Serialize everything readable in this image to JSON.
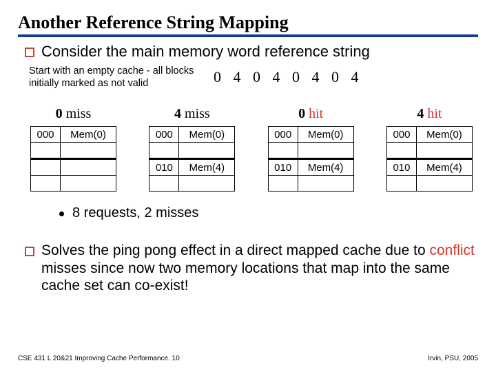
{
  "title": "Another Reference String Mapping",
  "bullet1": "Consider the main memory word reference string",
  "sub_left": "Start with an empty cache - all blocks initially marked as not valid",
  "ref_string": "0 4 0 4 0 4 0 4",
  "cols": [
    {
      "hn": "0",
      "ht": "miss",
      "hitclass": "",
      "rows": [
        [
          "000",
          "Mem(0)"
        ],
        [
          "",
          ""
        ],
        [
          "",
          ""
        ],
        [
          "",
          ""
        ]
      ]
    },
    {
      "hn": "4",
      "ht": "miss",
      "hitclass": "",
      "rows": [
        [
          "000",
          "Mem(0)"
        ],
        [
          "",
          ""
        ],
        [
          "010",
          "Mem(4)"
        ],
        [
          "",
          ""
        ]
      ]
    },
    {
      "hn": "0",
      "ht": "hit",
      "hitclass": "hit",
      "rows": [
        [
          "000",
          "Mem(0)"
        ],
        [
          "",
          ""
        ],
        [
          "010",
          "Mem(4)"
        ],
        [
          "",
          ""
        ]
      ]
    },
    {
      "hn": "4",
      "ht": "hit",
      "hitclass": "hit",
      "rows": [
        [
          "000",
          "Mem(0)"
        ],
        [
          "",
          ""
        ],
        [
          "010",
          "Mem(4)"
        ],
        [
          "",
          ""
        ]
      ]
    }
  ],
  "requests": "8 requests, 2 misses",
  "solve_pre": "Solves the ping pong effect in a direct mapped cache due to ",
  "solve_conf": "conflict",
  "solve_post": " misses since now two memory locations that map into the same cache set can co-exist!",
  "footer_left": "CSE 431  L 20&21 Improving Cache Performance. 10",
  "footer_right": "Irvin, PSU, 2005",
  "chart_data": {
    "type": "table",
    "title": "Another Reference String Mapping",
    "reference_string": [
      0,
      4,
      0,
      4,
      0,
      4,
      0,
      4
    ],
    "steps": [
      {
        "access": 0,
        "result": "miss",
        "cache": [
          [
            "000",
            "Mem(0)"
          ],
          null,
          null,
          null
        ]
      },
      {
        "access": 4,
        "result": "miss",
        "cache": [
          [
            "000",
            "Mem(0)"
          ],
          null,
          [
            "010",
            "Mem(4)"
          ],
          null
        ]
      },
      {
        "access": 0,
        "result": "hit",
        "cache": [
          [
            "000",
            "Mem(0)"
          ],
          null,
          [
            "010",
            "Mem(4)"
          ],
          null
        ]
      },
      {
        "access": 4,
        "result": "hit",
        "cache": [
          [
            "000",
            "Mem(0)"
          ],
          null,
          [
            "010",
            "Mem(4)"
          ],
          null
        ]
      }
    ],
    "summary": {
      "requests": 8,
      "misses": 2
    }
  }
}
